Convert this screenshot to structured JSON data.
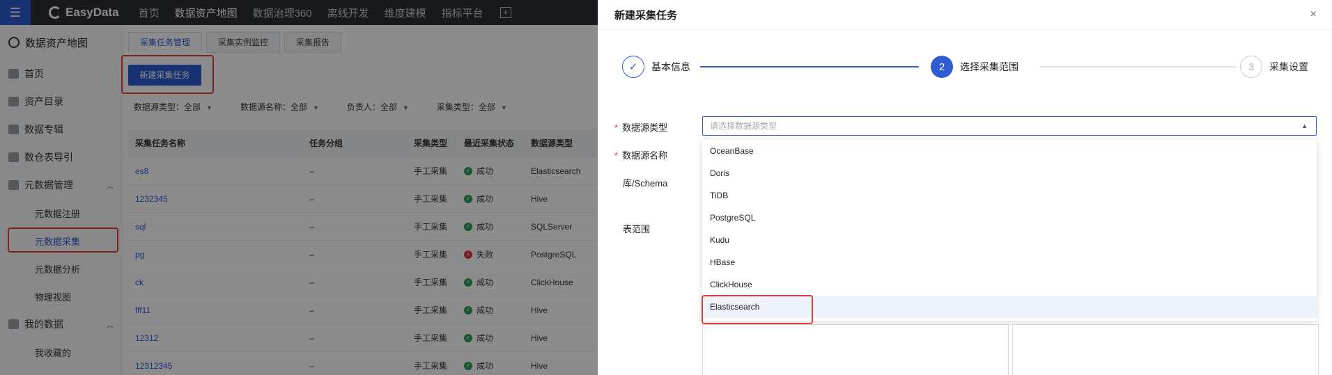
{
  "topnav": {
    "logo": "EasyData",
    "items": [
      "首页",
      "数据资产地图",
      "数据治理360",
      "离线开发",
      "维度建模",
      "指标平台"
    ]
  },
  "sidebar": {
    "title": "数据资产地图",
    "items": [
      "首页",
      "资产目录",
      "数据专辑",
      "数仓表导引"
    ],
    "group1": {
      "label": "元数据管理",
      "children": [
        "元数据注册",
        "元数据采集",
        "元数据分析",
        "物理视图"
      ]
    },
    "group2": {
      "label": "我的数据",
      "children": [
        "我收藏的"
      ]
    }
  },
  "main": {
    "tabs": [
      "采集任务管理",
      "采集实例监控",
      "采集报告"
    ],
    "new_button": "新建采集任务",
    "filters": [
      "数据源类型：全部",
      "数据源名称：全部",
      "负责人：全部",
      "采集类型：全部"
    ],
    "columns": [
      "采集任务名称",
      "任务分组",
      "采集类型",
      "最近采集状态",
      "数据源类型"
    ],
    "rows": [
      {
        "name": "es8",
        "group": "–",
        "type": "手工采集",
        "status": "成功",
        "ok": true,
        "ds": "Elasticsearch"
      },
      {
        "name": "1232345",
        "group": "–",
        "type": "手工采集",
        "status": "成功",
        "ok": true,
        "ds": "Hive"
      },
      {
        "name": "sql",
        "group": "–",
        "type": "手工采集",
        "status": "成功",
        "ok": true,
        "ds": "SQLServer"
      },
      {
        "name": "pg",
        "group": "–",
        "type": "手工采集",
        "status": "失败",
        "ok": false,
        "ds": "PostgreSQL"
      },
      {
        "name": "ck",
        "group": "–",
        "type": "手工采集",
        "status": "成功",
        "ok": true,
        "ds": "ClickHouse"
      },
      {
        "name": "fff11",
        "group": "–",
        "type": "手工采集",
        "status": "成功",
        "ok": true,
        "ds": "Hive"
      },
      {
        "name": "12312",
        "group": "–",
        "type": "手工采集",
        "status": "成功",
        "ok": true,
        "ds": "Hive"
      },
      {
        "name": "12312345",
        "group": "–",
        "type": "手工采集",
        "status": "成功",
        "ok": true,
        "ds": "Hive"
      }
    ]
  },
  "drawer": {
    "title": "新建采集任务",
    "close": "×",
    "steps": [
      {
        "num": "✓",
        "label": "基本信息",
        "state": "done"
      },
      {
        "num": "2",
        "label": "选择采集范围",
        "state": "current"
      },
      {
        "num": "3",
        "label": "采集设置",
        "state": "todo"
      }
    ],
    "labels": {
      "ds_type": "数据源类型",
      "ds_name": "数据源名称",
      "schema": "库/Schema",
      "table_range": "表范围"
    },
    "ds_type_placeholder": "请选择数据源类型",
    "options": [
      "OceanBase",
      "Doris",
      "TiDB",
      "PostgreSQL",
      "Kudu",
      "HBase",
      "ClickHouse",
      "Elasticsearch"
    ],
    "highlighted_option": "Elasticsearch"
  },
  "colors": {
    "accent": "#2f5bd3",
    "success": "#29a35a",
    "fail": "#e0383e",
    "annotation": "#e53c3c"
  }
}
